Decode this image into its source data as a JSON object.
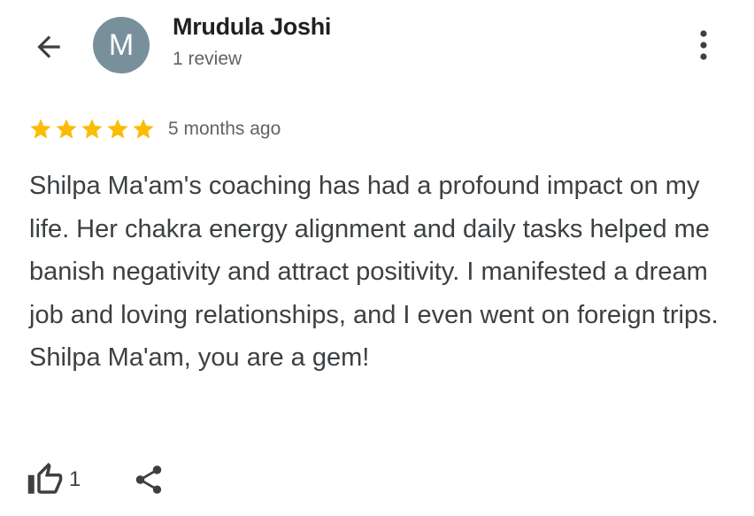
{
  "header": {
    "back_icon": "arrow-left-icon",
    "avatar_letter": "M",
    "avatar_color": "#78909c",
    "reviewer_name": "Mrudula Joshi",
    "review_count": "1 review",
    "menu_icon": "more-vertical-icon"
  },
  "review": {
    "rating": 5,
    "rating_max": 5,
    "star_color": "#fbbc04",
    "time": "5 months ago",
    "text": "Shilpa Ma'am's coaching has had a profound impact on my life. Her chakra energy alignment and daily tasks helped me banish negativity and attract positivity. I manifested a dream job and loving relationships, and I even went on foreign trips. Shilpa Ma'am, you are a gem!"
  },
  "actions": {
    "like_icon": "thumbs-up-icon",
    "like_count": "1",
    "share_icon": "share-icon"
  }
}
